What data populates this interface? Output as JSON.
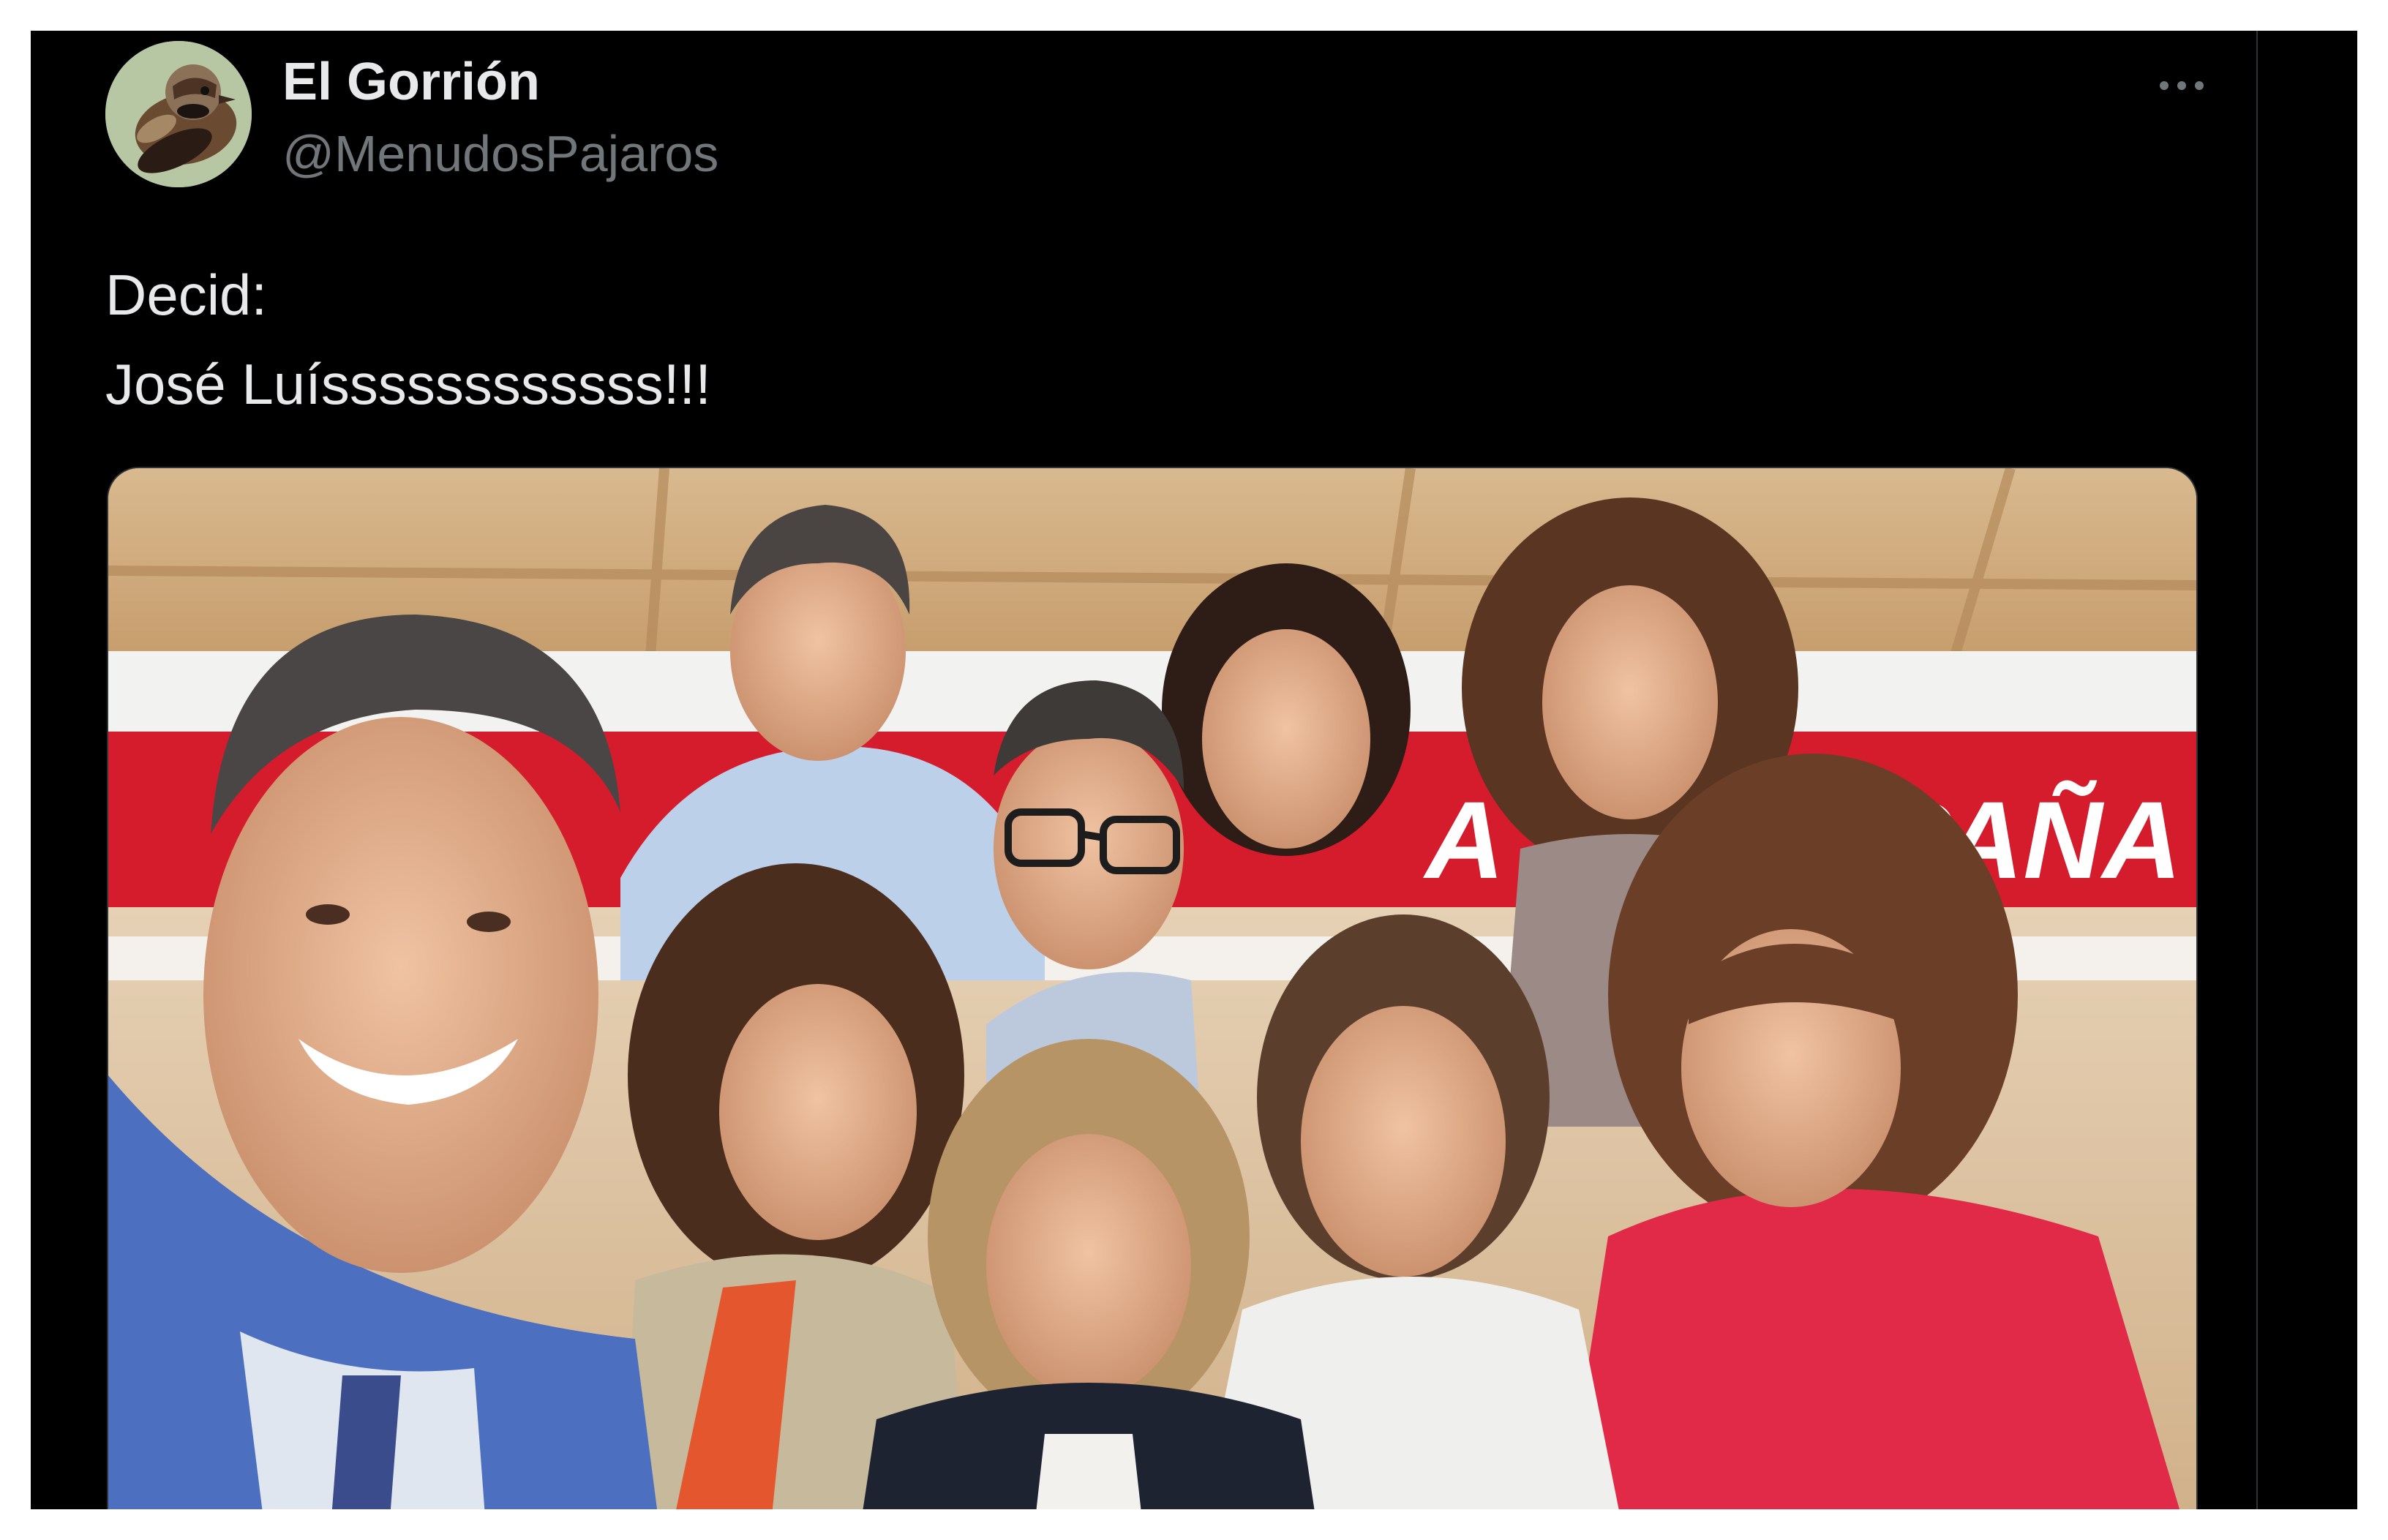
{
  "tweet": {
    "author": {
      "display_name": "El Gorrión",
      "handle": "@MenudosPajaros",
      "avatar_icon": "sparrow-avatar-icon"
    },
    "text_lines": [
      "Decid:",
      "José Luíssssssssssss!!!"
    ],
    "more_icon": "more-options-icon",
    "media": {
      "kind": "photo",
      "banner_text_left": "A",
      "banner_text_right": "SPAÑA"
    }
  },
  "colors": {
    "background": "#000000",
    "primary_text": "#e7e9ea",
    "secondary_text": "#71767b",
    "border": "#2f3336"
  }
}
